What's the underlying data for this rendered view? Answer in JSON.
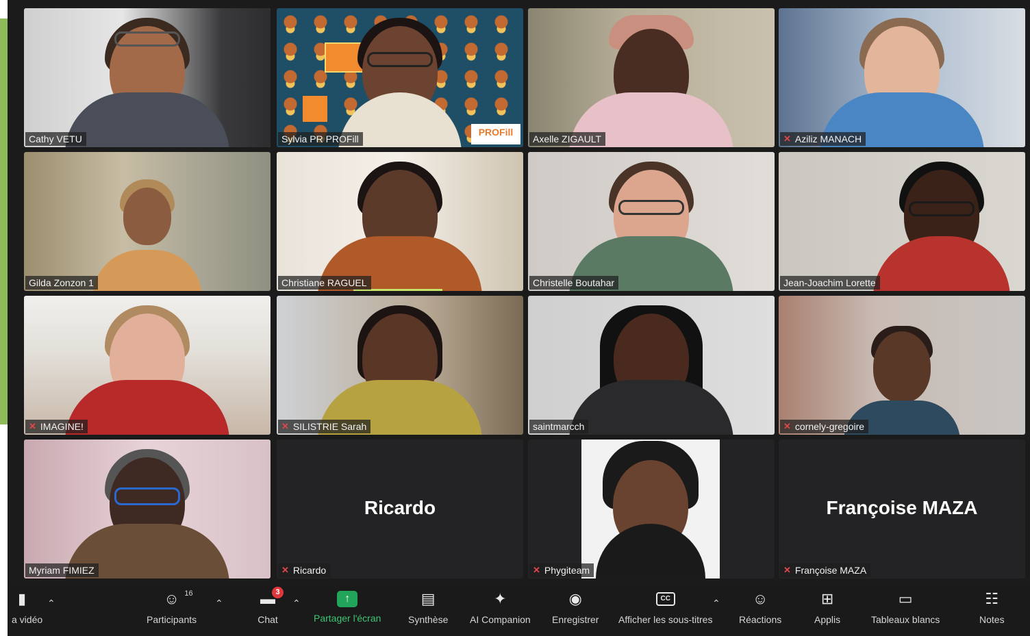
{
  "participants": [
    {
      "name": "Cathy VETU",
      "muted": false,
      "active": true
    },
    {
      "name": "Sylvia PR PROFill",
      "muted": false,
      "active": false
    },
    {
      "name": "Axelle ZIGAULT",
      "muted": false,
      "active": false
    },
    {
      "name": "Aziliz MANACH",
      "muted": true,
      "active": false
    },
    {
      "name": "Gilda Zonzon 1",
      "muted": false,
      "active": false
    },
    {
      "name": "Christiane RAGUEL",
      "muted": false,
      "active": false
    },
    {
      "name": "Christelle Boutahar",
      "muted": false,
      "active": false
    },
    {
      "name": "Jean-Joachim Lorette",
      "muted": false,
      "active": false
    },
    {
      "name": "IMAGINE!",
      "muted": true,
      "active": false
    },
    {
      "name": "SILISTRIE Sarah",
      "muted": true,
      "active": false
    },
    {
      "name": "saintmarcch",
      "muted": false,
      "active": false
    },
    {
      "name": "cornely-gregoire",
      "muted": true,
      "active": false
    },
    {
      "name": "Myriam FIMIEZ",
      "muted": false,
      "active": true
    },
    {
      "name": "Ricardo",
      "muted": true,
      "active": false,
      "display_name": "Ricardo"
    },
    {
      "name": "Phygiteam",
      "muted": true,
      "active": false
    },
    {
      "name": "Françoise MAZA",
      "muted": true,
      "active": false,
      "display_name": "Françoise MAZA"
    }
  ],
  "profil_logo": "PROFill",
  "toolbar": {
    "video_label": "a vidéo",
    "participants_label": "Participants",
    "participants_count": "16",
    "chat_label": "Chat",
    "chat_badge": "3",
    "share_label": "Partager l'écran",
    "synthese_label": "Synthèse",
    "ai_label": "AI Companion",
    "record_label": "Enregistrer",
    "captions_label": "Afficher les sous-titres",
    "captions_icon_text": "CC",
    "reactions_label": "Réactions",
    "apps_label": "Applis",
    "whiteboards_label": "Tableaux blancs",
    "notes_label": "Notes"
  },
  "colors": {
    "active_speaker": "#c7e36a",
    "muted_icon": "#e0474c",
    "share_button": "#22a55b",
    "toolbar_bg": "#1a1a1b",
    "green_strip": "#8fba5a"
  }
}
